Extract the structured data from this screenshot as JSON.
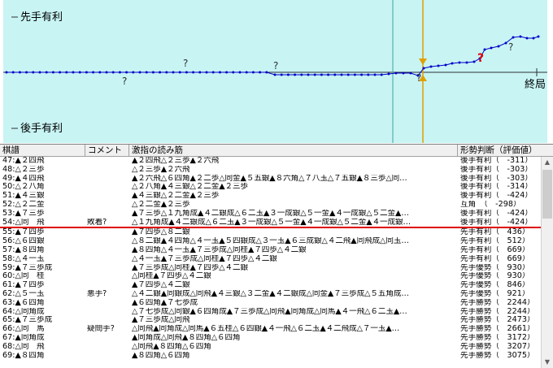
{
  "graph": {
    "label_top": "先手有利",
    "label_bottom": "後手有利",
    "label_end": "終局",
    "question_mark": "?",
    "bg_color": "#c8f4f4",
    "line_color": "#0000c8",
    "cursor_color": "#e0a000",
    "marker_red": "#e00000"
  },
  "table": {
    "headers": {
      "move": "棋譜",
      "comment": "コメント",
      "pv": "激指の読み筋",
      "eval": "形勢判断（評価値）"
    },
    "rows": [
      {
        "move": "47:▲２四飛",
        "comment": "",
        "pv": "▲２四飛△２三歩▲２六飛",
        "eval": "後手有利（　-311）"
      },
      {
        "move": "48:△２三歩",
        "comment": "",
        "pv": "△２三歩▲２六飛",
        "eval": "後手有利（　-303）"
      },
      {
        "move": "49:▲４四飛",
        "comment": "",
        "pv": "▲２六飛△６四角▲２二歩△同金▲５五銀▲８六角△７八玉△７五銀▲８三歩△同…",
        "eval": "後手有利（　-303）"
      },
      {
        "move": "50:△２八角",
        "comment": "",
        "pv": "△２八角▲４三銀△２二金▲２三歩",
        "eval": "後手有利（　-314）"
      },
      {
        "move": "51:▲４三銀",
        "comment": "",
        "pv": "▲４三銀△２二金▲２三歩",
        "eval": "後手有利（　-424）"
      },
      {
        "move": "52:△２二金",
        "comment": "",
        "pv": "△２二金▲２三歩",
        "eval": "互角　（　-298）"
      },
      {
        "move": "53:▲７三歩",
        "comment": "",
        "pv": "▲７三歩△１九角成▲４二銀成△６二玉▲３一成銀△５一金▲４一成銀△５二金▲…",
        "eval": "後手有利（　-424）"
      },
      {
        "move": "54:△同　飛",
        "comment": "敗着?",
        "pv": "△１九角成▲４二銀成△６二玉▲３一成銀△５一金▲４一成銀△５二金▲４一成銀…",
        "eval": "後手有利（　-424）"
      },
      {
        "move": "55:▲７四歩",
        "comment": "",
        "pv": "▲７四歩△８二銀",
        "eval": "先手有利（　436）"
      },
      {
        "move": "56:△６四銀",
        "comment": "",
        "pv": "△８二銀▲４四角△４一玉▲５四銀成△３一玉▲６三成銀△４二飛▲同飛成△同玉…",
        "eval": "先手有利（　512）"
      },
      {
        "move": "57:▲８四角",
        "comment": "",
        "pv": "▲８四角△４一玉▲７三歩成△同桂▲７四歩△４二銀",
        "eval": "先手有利（　669）"
      },
      {
        "move": "58:△４一玉",
        "comment": "",
        "pv": "△４一玉▲７三歩成△同桂▲７四歩△４二銀",
        "eval": "先手有利（　669）"
      },
      {
        "move": "59:▲７三歩成",
        "comment": "",
        "pv": "▲７三歩成△同桂▲７四歩△４二銀",
        "eval": "先手優勢（　930）"
      },
      {
        "move": "60:△同　桂",
        "comment": "",
        "pv": "△同桂▲７四歩△４二銀",
        "eval": "先手優勢（　930）"
      },
      {
        "move": "61:▲７四歩",
        "comment": "",
        "pv": "▲７四歩△４二銀",
        "eval": "先手優勢（　846）"
      },
      {
        "move": "62:△５一玉",
        "comment": "悪手?",
        "pv": "△４二銀▲同銀成△同飛▲４三銀△３二金▲４二銀成△同金▲７三歩成△５五角成…",
        "eval": "先手優勢（　921）"
      },
      {
        "move": "63:▲６四角",
        "comment": "",
        "pv": "▲６四角▲７七歩成",
        "eval": "先手勝勢（　2244）"
      },
      {
        "move": "64:△同角成",
        "comment": "",
        "pv": "△７七歩成△同銀▲６四角成▲７三歩成△同飛▲同角成△同馬▲４一飛△６二玉▲…",
        "eval": "先手勝勢（　2244）"
      },
      {
        "move": "65:▲７三歩成",
        "comment": "",
        "pv": "▲７三歩成△同飛",
        "eval": "先手勝勢（　2473）"
      },
      {
        "move": "66:△同　馬",
        "comment": "疑問手?",
        "pv": "△同飛▲同角成△同馬▲６五桂△６四銀▲４一飛△６二玉▲４二飛成△７一玉▲…",
        "eval": "先手勝勢（　2661）"
      },
      {
        "move": "67:▲同角成",
        "comment": "",
        "pv": "▲同角成△同飛▲８四角△６四角",
        "eval": "先手勝勢（　3172）"
      },
      {
        "move": "68:△同　飛",
        "comment": "",
        "pv": "△同飛▲８四角△６四角",
        "eval": "先手勝勢（　3207）"
      },
      {
        "move": "69:▲８四角",
        "comment": "",
        "pv": "▲８四角△６四角",
        "eval": "先手勝勢（　3075）"
      }
    ],
    "selected_index": 7
  }
}
